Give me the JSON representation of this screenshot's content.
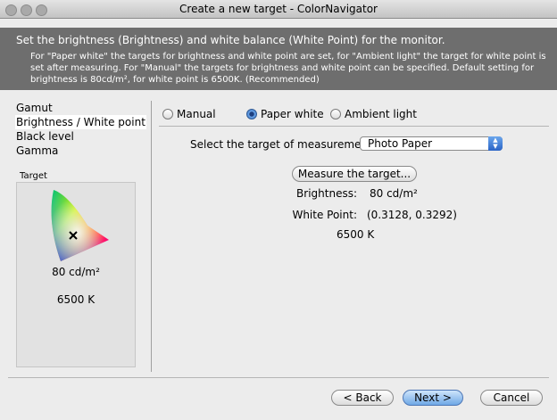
{
  "window": {
    "title": "Create a new target - ColorNavigator"
  },
  "banner": {
    "heading": "Set the brightness (Brightness) and white balance (White Point) for the monitor.",
    "description": "For \"Paper white\" the targets for brightness and white point are set, for \"Ambient light\" the target for white point is set after measuring. For \"Manual\" the targets for brightness and white point can be specified. Default setting for brightness is 80cd/m², for white point is 6500K. (Recommended)"
  },
  "steps": [
    "Gamut",
    "Brightness / White point",
    "Black level",
    "Gamma"
  ],
  "target_panel": {
    "label": "Target",
    "brightness": "80 cd/m²",
    "white_point": "6500 K"
  },
  "mode": {
    "options": [
      "Manual",
      "Paper white",
      "Ambient light"
    ],
    "selected": "Paper white"
  },
  "measurement": {
    "label": "Select the target of measurement:",
    "selected": "Photo Paper",
    "measure_button": "Measure the target..."
  },
  "results": {
    "brightness_label": "Brightness:",
    "brightness_value": "80 cd/m²",
    "white_point_label": "White Point:",
    "white_point_value": "(0.3128, 0.3292)",
    "color_temperature": "6500 K"
  },
  "buttons": {
    "back": "< Back",
    "next": "Next >",
    "cancel": "Cancel"
  }
}
